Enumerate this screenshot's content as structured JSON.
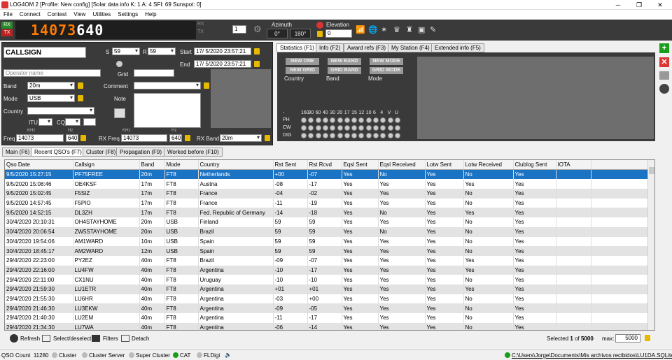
{
  "window": {
    "title": "LOG4OM 2 [Profile: New config] [Solar data info K: 1 A: 4 SFI: 69 Sunspot: 0]"
  },
  "menu": [
    "File",
    "Connect",
    "Contest",
    "View",
    "Utilities",
    "Settings",
    "Help"
  ],
  "toolbar": {
    "rx": "RX",
    "tx": "TX",
    "freq_main": "14073",
    "freq_sub": "640",
    "rx_small": "RX",
    "tx_small": "TX",
    "slot": "1",
    "azimuth_label": "Azimuth",
    "az_left": "0°",
    "az_right": "180°",
    "elevation_label": "Elevation",
    "elevation_value": "0"
  },
  "qso": {
    "callsign": "CALLSIGN",
    "s_label": "S",
    "s_value": "59",
    "r_label": "R",
    "r_value": "59",
    "start_label": "Start",
    "start_value": "17/  5/2020 23:57:21",
    "end_label": "End",
    "end_value": "17/  5/2020 23:57:21",
    "operator_placeholder": "Operator name",
    "grid_label": "Grid",
    "band_label": "Band",
    "band_value": "20m",
    "comment_label": "Comment",
    "mode_label": "Mode",
    "mode_value": "USB",
    "note_label": "Note",
    "country_label": "Country",
    "itu_label": "ITU",
    "cq_label": "CQ",
    "freq_label": "Freq",
    "khz": "KHz",
    "hz": "Hz",
    "freq_value": "14073",
    "freq_hz": "640",
    "rxfreq_label": "RX Freq",
    "rxfreq_value": "14073",
    "rxfreq_hz": "640",
    "rxband_label": "RX Band",
    "rxband_value": "20m"
  },
  "stats": {
    "tabs": [
      "Statistics (F1)",
      "Info (F2)",
      "Award refs (F3)",
      "My Station (F4)",
      "Extended info (F5)"
    ],
    "buttons": [
      [
        "NEW ONE",
        "NEW BAND",
        "NEW MODE"
      ],
      [
        "NEW GRID",
        "GRID BAND",
        "GRID MODE"
      ]
    ],
    "cols": [
      "Country",
      "Band",
      "Mode"
    ],
    "bands_header": [
      "-",
      "160",
      "80",
      "60",
      "40",
      "30",
      "20",
      "17",
      "15",
      "12",
      "10",
      "6",
      "4",
      "V",
      "U"
    ],
    "modes": [
      "PH",
      "CW",
      "DIG"
    ]
  },
  "main_tabs": [
    "Main (F6)",
    "Recent QSO's (F7)",
    "Cluster (F8)",
    "Propagation (F9)",
    "Worked before (F10)"
  ],
  "table": {
    "headers": [
      "Qso Date",
      "Callsign",
      "Band",
      "Mode",
      "Country",
      "Rst Sent",
      "Rst Rcvd",
      "Eqsl Sent",
      "Eqsl Received",
      "Lotw Sent",
      "Lotw Received",
      "Clublog Sent",
      "IOTA"
    ],
    "rows": [
      [
        "9/5/2020 15:27:15",
        "PF75FREE",
        "20m",
        "FT8",
        "Netherlands",
        "+00",
        "-07",
        "Yes",
        "No",
        "Yes",
        "No",
        "Yes",
        ""
      ],
      [
        "9/5/2020 15:08:46",
        "OE4KSF",
        "17m",
        "FT8",
        "Austria",
        "-08",
        "-17",
        "Yes",
        "Yes",
        "Yes",
        "Yes",
        "Yes",
        ""
      ],
      [
        "9/5/2020 15:02:45",
        "F5SIZ",
        "17m",
        "FT8",
        "France",
        "-04",
        "-02",
        "Yes",
        "Yes",
        "Yes",
        "No",
        "Yes",
        ""
      ],
      [
        "9/5/2020 14:57:45",
        "F5PIO",
        "17m",
        "FT8",
        "France",
        "-11",
        "-19",
        "Yes",
        "Yes",
        "Yes",
        "No",
        "Yes",
        ""
      ],
      [
        "9/5/2020 14:52:15",
        "DL3ZH",
        "17m",
        "FT8",
        "Fed. Republic of Germany",
        "-14",
        "-18",
        "Yes",
        "No",
        "Yes",
        "Yes",
        "Yes",
        ""
      ],
      [
        "30/4/2020 20:10:31",
        "OH4STAYHOME",
        "20m",
        "USB",
        "Finland",
        "59",
        "59",
        "Yes",
        "Yes",
        "Yes",
        "No",
        "Yes",
        ""
      ],
      [
        "30/4/2020 20:06:54",
        "ZW5STAYHOME",
        "20m",
        "USB",
        "Brazil",
        "59",
        "59",
        "Yes",
        "No",
        "Yes",
        "No",
        "Yes",
        ""
      ],
      [
        "30/4/2020 19:54:06",
        "AM1WARD",
        "10m",
        "USB",
        "Spain",
        "59",
        "59",
        "Yes",
        "Yes",
        "Yes",
        "No",
        "Yes",
        ""
      ],
      [
        "30/4/2020 18:45:17",
        "AM2WARD",
        "12m",
        "USB",
        "Spain",
        "59",
        "59",
        "Yes",
        "Yes",
        "Yes",
        "No",
        "Yes",
        ""
      ],
      [
        "29/4/2020 22:23:00",
        "PY2EZ",
        "40m",
        "FT8",
        "Brazil",
        "-09",
        "-07",
        "Yes",
        "Yes",
        "Yes",
        "Yes",
        "Yes",
        ""
      ],
      [
        "29/4/2020 22:16:00",
        "LU4FW",
        "40m",
        "FT8",
        "Argentina",
        "-10",
        "-17",
        "Yes",
        "Yes",
        "Yes",
        "Yes",
        "Yes",
        ""
      ],
      [
        "29/4/2020 22:11:00",
        "CX1NU",
        "40m",
        "FT8",
        "Uruguay",
        "-10",
        "-10",
        "Yes",
        "Yes",
        "Yes",
        "No",
        "Yes",
        ""
      ],
      [
        "29/4/2020 21:59:30",
        "LU1ETR",
        "40m",
        "FT8",
        "Argentina",
        "+01",
        "+01",
        "Yes",
        "Yes",
        "Yes",
        "Yes",
        "Yes",
        ""
      ],
      [
        "29/4/2020 21:55:30",
        "LU6HR",
        "40m",
        "FT8",
        "Argentina",
        "-03",
        "+00",
        "Yes",
        "Yes",
        "Yes",
        "No",
        "Yes",
        ""
      ],
      [
        "29/4/2020 21:46:30",
        "LU3EKW",
        "40m",
        "FT8",
        "Argentina",
        "-09",
        "-05",
        "Yes",
        "Yes",
        "Yes",
        "No",
        "Yes",
        ""
      ],
      [
        "29/4/2020 21:40:30",
        "LU2EM",
        "40m",
        "FT8",
        "Argentina",
        "-11",
        "-17",
        "Yes",
        "Yes",
        "Yes",
        "No",
        "Yes",
        ""
      ],
      [
        "29/4/2020 21:34:30",
        "LU7WA",
        "40m",
        "FT8",
        "Argentina",
        "-06",
        "-14",
        "Yes",
        "Yes",
        "Yes",
        "No",
        "Yes",
        ""
      ]
    ]
  },
  "bottom": {
    "refresh": "Refresh",
    "select": "Select/deselect",
    "filters": "Filters",
    "detach": "Detach",
    "selected_label": "Selected",
    "selected_value": "1",
    "of_label": "of",
    "total": "5000",
    "max_label": "max:",
    "max_value": "5000"
  },
  "status": {
    "qso_count_label": "QSO Count",
    "qso_count": "11280",
    "items": [
      "Cluster",
      "Cluster Server",
      "Super Cluster",
      "CAT",
      "FLDigi"
    ],
    "path": "C:\\Users\\Jorge\\Documents\\Mis archivos recibidos\\LU1DA.SQLite"
  }
}
